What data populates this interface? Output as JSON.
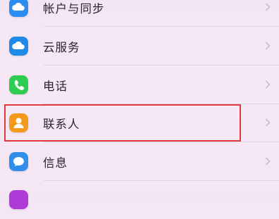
{
  "settings": {
    "items": [
      {
        "label": "帐户与同步",
        "icon": "cloud-icon",
        "icon_color": "#2a8df0"
      },
      {
        "label": "云服务",
        "icon": "cloud-icon",
        "icon_color": "#1f8be8"
      },
      {
        "label": "电话",
        "icon": "phone-icon",
        "icon_color": "#2ecc50"
      },
      {
        "label": "联系人",
        "icon": "person-icon",
        "icon_color": "#f39a1c"
      },
      {
        "label": "信息",
        "icon": "message-icon",
        "icon_color": "#2f8fe9"
      }
    ]
  },
  "highlight": {
    "color": "#e03a3e",
    "target": "联系人"
  }
}
